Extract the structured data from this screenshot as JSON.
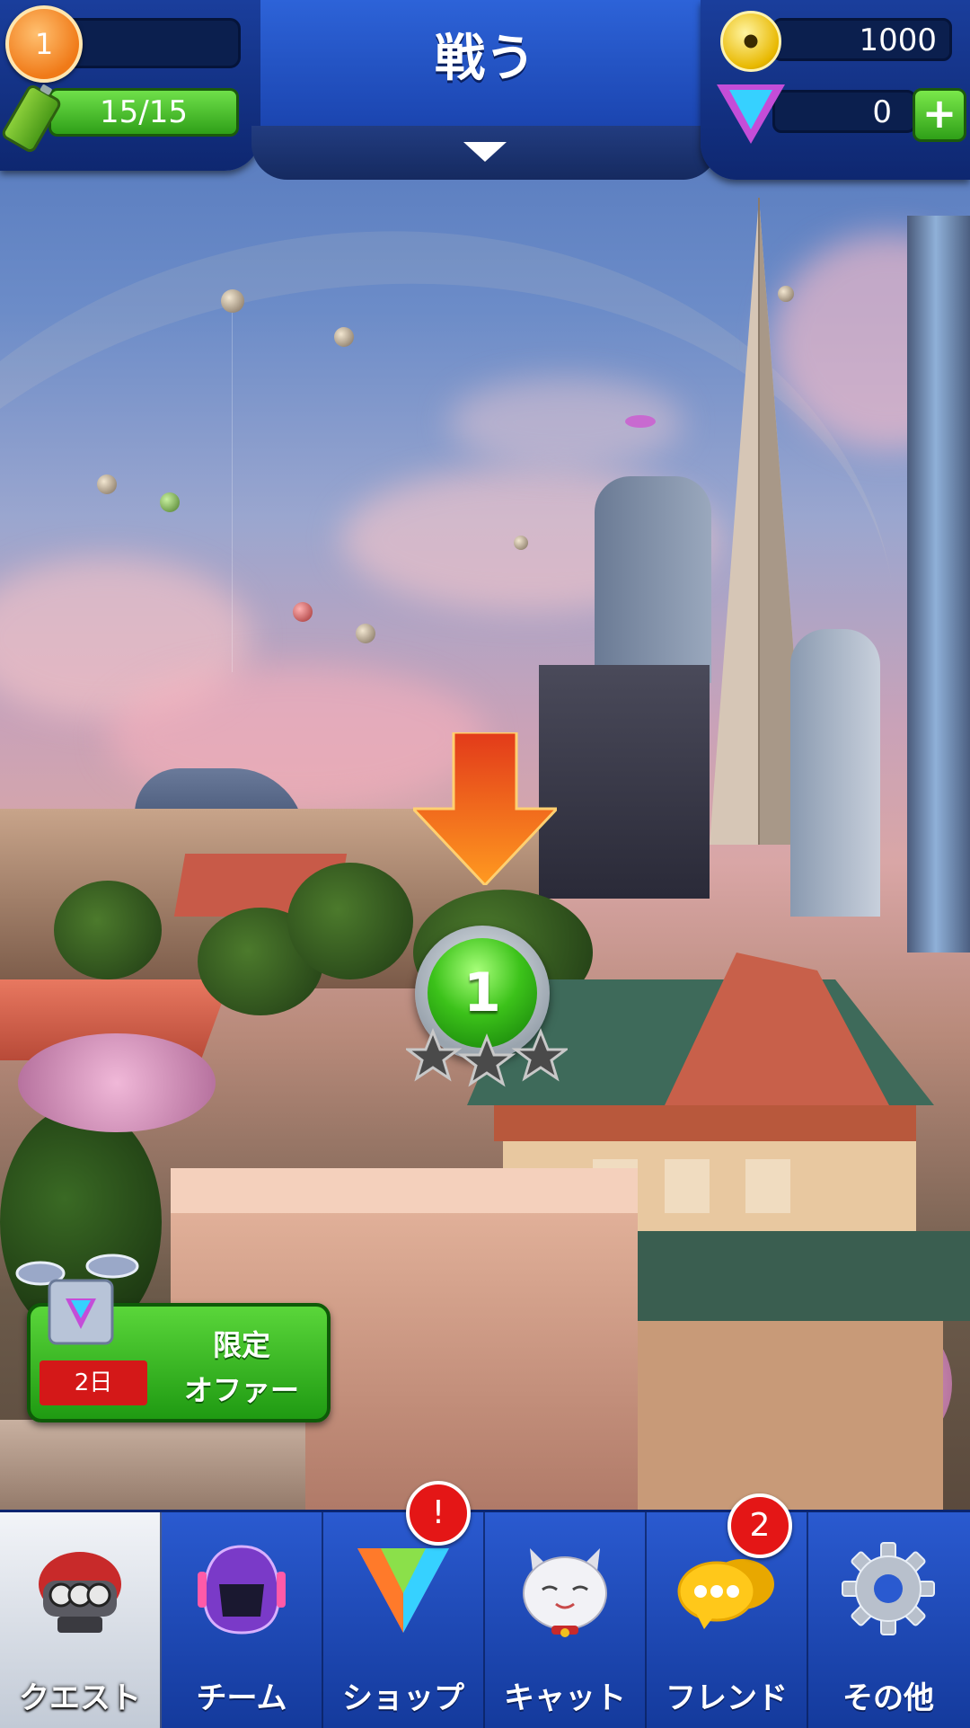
{
  "header": {
    "title": "戦う",
    "player_level": "1",
    "energy": "15/15",
    "coins": "1000",
    "gems": "0"
  },
  "map": {
    "current_level": "1",
    "stars_earned": 0,
    "stars_total": 3
  },
  "offer": {
    "title": "限定",
    "subtitle": "オファー",
    "days_left": "2日"
  },
  "bottom_nav": {
    "items": [
      {
        "label": "クエスト",
        "icon": "quest-robot-icon",
        "active": true
      },
      {
        "label": "チーム",
        "icon": "team-helmet-icon",
        "active": false
      },
      {
        "label": "ショップ",
        "icon": "shop-gem-icon",
        "active": false,
        "badge": "!"
      },
      {
        "label": "キャット",
        "icon": "cat-icon",
        "active": false
      },
      {
        "label": "フレンド",
        "icon": "friends-chat-icon",
        "active": false,
        "badge": "2"
      },
      {
        "label": "その他",
        "icon": "settings-gear-icon",
        "active": false
      }
    ]
  },
  "colors": {
    "nav_blue": "#2a5ad0",
    "energy_green": "#2fa018",
    "badge_red": "#e41616",
    "arrow_orange": "#f06a10"
  }
}
